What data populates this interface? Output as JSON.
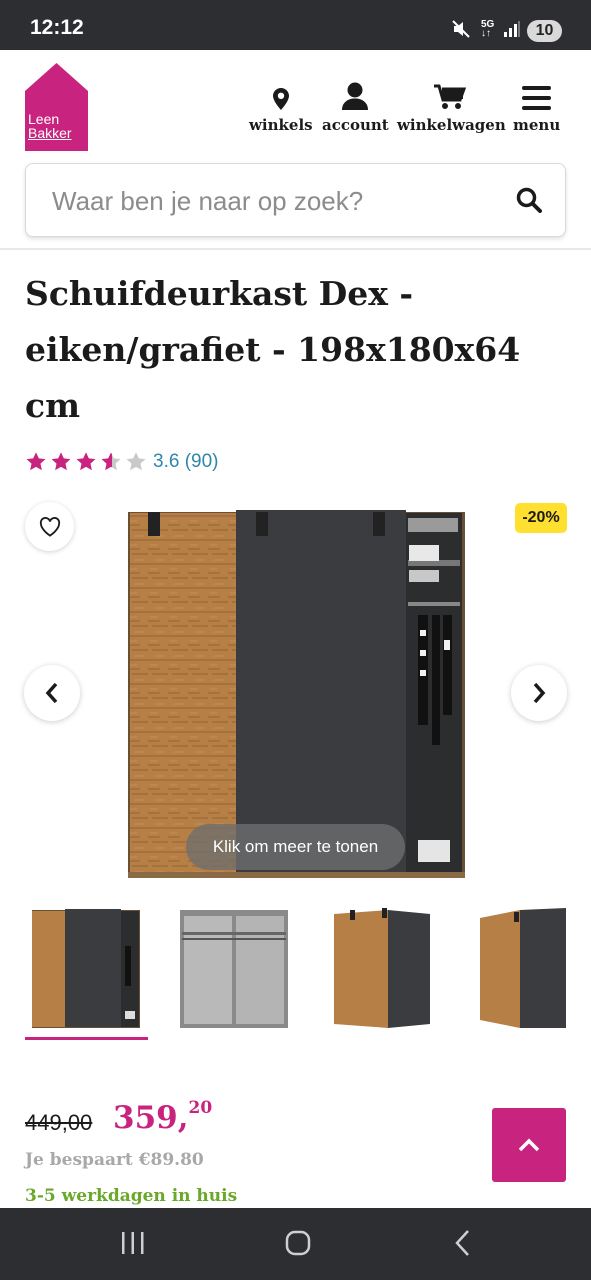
{
  "status_bar": {
    "time": "12:12",
    "network": "5G",
    "battery": "10"
  },
  "header": {
    "logo": {
      "line1": "Leen",
      "line2": "Bakker",
      "color": "#c8247f"
    },
    "nav": [
      {
        "label": "winkels",
        "icon": "map-pin-icon"
      },
      {
        "label": "account",
        "icon": "user-icon"
      },
      {
        "label": "winkelwagen",
        "icon": "cart-icon"
      },
      {
        "label": "menu",
        "icon": "hamburger-icon"
      }
    ]
  },
  "search": {
    "placeholder": "Waar ben je naar op zoek?"
  },
  "product": {
    "title": "Schuifdeurkast Dex - eiken/grafiet - 198x180x64 cm",
    "rating": {
      "score": 3.6,
      "max": 5,
      "text": "3.6 (90)"
    },
    "discount_badge": "-20%",
    "gallery": {
      "overlay_text": "Klik om meer te tonen",
      "thumbnail_count": 4,
      "selected_index": 0
    },
    "price": {
      "old": "449,00",
      "new_main": "359,",
      "new_cents": "20",
      "savings": "Je bespaart €89.80",
      "delivery": "3-5 werkdagen in huis"
    }
  },
  "colors": {
    "brand": "#c8247f",
    "badge": "#ffe02e",
    "rating_text": "#2e86ab",
    "delivery": "#6aa82a"
  }
}
